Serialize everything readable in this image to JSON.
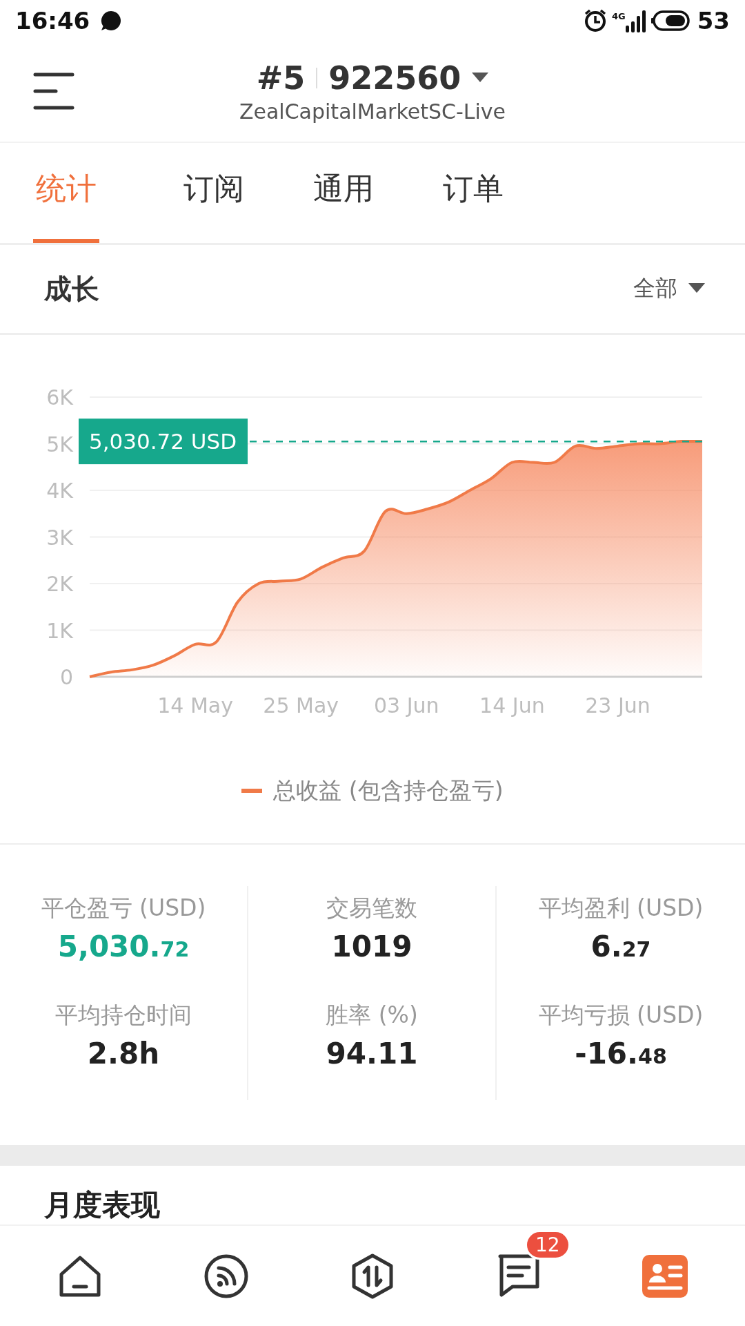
{
  "status_bar": {
    "time": "16:46",
    "network": "4G",
    "battery": "53"
  },
  "header": {
    "account_index": "#5",
    "account_number": "922560",
    "server": "ZealCapitalMarketSC-Live"
  },
  "tabs": [
    {
      "label": "统计",
      "selected": true
    },
    {
      "label": "订阅",
      "selected": false
    },
    {
      "label": "通用",
      "selected": false
    },
    {
      "label": "订单",
      "selected": false
    }
  ],
  "growth": {
    "title": "成长",
    "filter": "全部",
    "chart_data": {
      "type": "area",
      "ylim": [
        0,
        6000
      ],
      "yticks": [
        {
          "value": 0,
          "label": "0"
        },
        {
          "value": 1000,
          "label": "1K"
        },
        {
          "value": 2000,
          "label": "2K"
        },
        {
          "value": 3000,
          "label": "3K"
        },
        {
          "value": 4000,
          "label": "4K"
        },
        {
          "value": 5000,
          "label": "5K"
        },
        {
          "value": 6000,
          "label": "6K"
        }
      ],
      "categories": [
        null,
        null,
        null,
        null,
        null,
        "14 May",
        null,
        null,
        null,
        null,
        "25 May",
        null,
        null,
        null,
        null,
        "03 Jun",
        null,
        null,
        null,
        null,
        "14 Jun",
        null,
        null,
        null,
        null,
        "23 Jun",
        null,
        null,
        null,
        null
      ],
      "series": [
        {
          "name": "总收益 (包含持仓盈亏)",
          "color": "#f07a48",
          "values": [
            0,
            100,
            150,
            250,
            450,
            700,
            750,
            1600,
            2000,
            2050,
            2100,
            2350,
            2550,
            2700,
            3550,
            3500,
            3600,
            3750,
            4000,
            4250,
            4600,
            4600,
            4600,
            4950,
            4900,
            4950,
            5000,
            5000,
            5050,
            5050
          ]
        }
      ],
      "grid": true,
      "annotations": [
        "5,030.72 USD"
      ]
    }
  },
  "stats": [
    {
      "label": "平仓盈亏 (USD)",
      "value": "5,030.",
      "decimals": "72",
      "color": "#16a88c"
    },
    {
      "label": "交易笔数",
      "value": "1019",
      "color": "#222222"
    },
    {
      "label": "平均盈利 (USD)",
      "value": "6.",
      "decimals": "27",
      "color": "#222222"
    },
    {
      "label": "平均持仓时间",
      "value": "2.8h",
      "color": "#222222"
    },
    {
      "label": "胜率 (%)",
      "value": "94.11",
      "color": "#222222"
    },
    {
      "label": "平均亏损 (USD)",
      "value": "-16.",
      "decimals": "48",
      "color": "#222222"
    }
  ],
  "monthly": {
    "title": "月度表现"
  },
  "bottom_nav": [
    {
      "kind": "home",
      "selected": false
    },
    {
      "kind": "feed",
      "selected": false
    },
    {
      "kind": "trade",
      "selected": false
    },
    {
      "kind": "messages",
      "selected": false,
      "badge": "12"
    },
    {
      "kind": "profile",
      "selected": true
    }
  ]
}
